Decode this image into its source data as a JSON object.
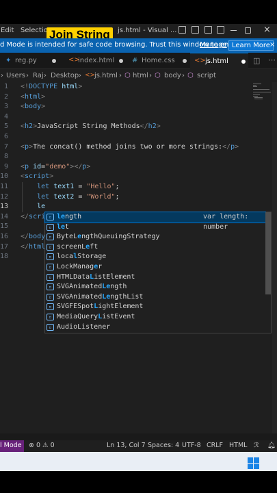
{
  "caption": "Join String",
  "titlebar": {
    "menu": [
      "Edit",
      "Selection"
    ],
    "title": "js.html - Visual ..."
  },
  "banner": {
    "message": "d Mode is intended for safe code browsing. Trust this window to en...",
    "manage": "Manage",
    "learn_more": "Learn More",
    "close": "×"
  },
  "tabs": [
    {
      "label": "reg.py",
      "icon": "python-icon"
    },
    {
      "label": "index.html",
      "icon": "html-icon"
    },
    {
      "label": "Home.css",
      "icon": "css-icon"
    },
    {
      "label": "js.html",
      "icon": "html-icon",
      "active": true
    }
  ],
  "breadcrumb": [
    "Users",
    "Raj",
    "Desktop",
    "js.html",
    "html",
    "body",
    "script"
  ],
  "editor": {
    "lines": [
      {
        "n": "1",
        "parts": [
          [
            "t",
            "<!"
          ],
          [
            "tg",
            "DOCTYPE"
          ],
          [
            "tx",
            " "
          ],
          [
            "at",
            "html"
          ],
          [
            "t",
            ">"
          ]
        ]
      },
      {
        "n": "2",
        "parts": [
          [
            "t",
            "<"
          ],
          [
            "tg",
            "html"
          ],
          [
            "t",
            ">"
          ]
        ]
      },
      {
        "n": "3",
        "parts": [
          [
            "t",
            "<"
          ],
          [
            "tg",
            "body"
          ],
          [
            "t",
            ">"
          ]
        ]
      },
      {
        "n": "4",
        "parts": []
      },
      {
        "n": "5",
        "parts": [
          [
            "t",
            "<"
          ],
          [
            "tg",
            "h2"
          ],
          [
            "t",
            ">"
          ],
          [
            "tx",
            "JavaScript String Methods"
          ],
          [
            "t",
            "</"
          ],
          [
            "tg",
            "h2"
          ],
          [
            "t",
            ">"
          ]
        ]
      },
      {
        "n": "6",
        "parts": []
      },
      {
        "n": "7",
        "parts": [
          [
            "t",
            "<"
          ],
          [
            "tg",
            "p"
          ],
          [
            "t",
            ">"
          ],
          [
            "tx",
            "The concat() method joins two or more strings:"
          ],
          [
            "t",
            "</"
          ],
          [
            "tg",
            "p"
          ],
          [
            "t",
            ">"
          ]
        ]
      },
      {
        "n": "8",
        "parts": []
      },
      {
        "n": "9",
        "parts": [
          [
            "t",
            "<"
          ],
          [
            "tg",
            "p"
          ],
          [
            "tx",
            " "
          ],
          [
            "at",
            "id"
          ],
          [
            "tx",
            "="
          ],
          [
            "st",
            "\"demo\""
          ],
          [
            "t",
            "></"
          ],
          [
            "tg",
            "p"
          ],
          [
            "t",
            ">"
          ]
        ]
      },
      {
        "n": "10",
        "parts": [
          [
            "t",
            "<"
          ],
          [
            "tg",
            "script"
          ],
          [
            "t",
            ">"
          ]
        ]
      },
      {
        "n": "11",
        "parts": [
          [
            "tx",
            "    "
          ],
          [
            "kw",
            "let"
          ],
          [
            "tx",
            " "
          ],
          [
            "vr",
            "text1"
          ],
          [
            "tx",
            " = "
          ],
          [
            "st",
            "\"Hello\""
          ],
          [
            "tx",
            ";"
          ]
        ]
      },
      {
        "n": "12",
        "parts": [
          [
            "tx",
            "    "
          ],
          [
            "kw",
            "let"
          ],
          [
            "tx",
            " "
          ],
          [
            "vr",
            "text2"
          ],
          [
            "tx",
            " = "
          ],
          [
            "st",
            "\"World\""
          ],
          [
            "tx",
            ";"
          ]
        ]
      },
      {
        "n": "13",
        "parts": [
          [
            "tx",
            "    "
          ],
          [
            "vr",
            "le"
          ]
        ],
        "current": true
      },
      {
        "n": "14",
        "parts": [
          [
            "t",
            "</"
          ],
          [
            "tg",
            "scri"
          ]
        ]
      },
      {
        "n": "15",
        "parts": []
      },
      {
        "n": "16",
        "parts": [
          [
            "t",
            "</"
          ],
          [
            "tg",
            "body"
          ]
        ]
      },
      {
        "n": "17",
        "parts": [
          [
            "t",
            "</"
          ],
          [
            "tg",
            "html"
          ]
        ]
      },
      {
        "n": "18",
        "parts": []
      }
    ]
  },
  "suggestions": {
    "detail": "var length: number",
    "items": [
      {
        "pre": "",
        "hl": "le",
        "post": "ngth"
      },
      {
        "pre": "",
        "hl": "le",
        "post": "t"
      },
      {
        "pre": "ByteL",
        "hl": "e",
        "post": "ngthQueuingStrategy"
      },
      {
        "pre": "screenL",
        "hl": "e",
        "post": "ft"
      },
      {
        "pre": "loca",
        "hl": "l",
        "post": "Storage"
      },
      {
        "pre": "LockManag",
        "hl": "e",
        "post": "r"
      },
      {
        "pre": "HTMLData",
        "hl": "L",
        "post": "istElement"
      },
      {
        "pre": "SVGAnimated",
        "hl": "Le",
        "post": "ngth"
      },
      {
        "pre": "SVGAnimated",
        "hl": "Le",
        "post": "ngthList"
      },
      {
        "pre": "SVGFESpot",
        "hl": "L",
        "post": "ightElement"
      },
      {
        "pre": "MediaQuery",
        "hl": "L",
        "post": "istEvent"
      },
      {
        "pre": "AudioListe",
        "hl": "",
        "post": "ner"
      }
    ]
  },
  "statusbar": {
    "mode": "l Mode",
    "problems": "⊗ 0 ⚠ 0",
    "position": "Ln 13, Col 7",
    "spaces": "Spaces: 4",
    "encoding": "UTF-8",
    "eol": "CRLF",
    "language": "HTML"
  },
  "colors": {
    "accent": "#0078d4",
    "banner": "#0a63b0",
    "caption": "#ffd100",
    "restricted": "#68217a"
  }
}
